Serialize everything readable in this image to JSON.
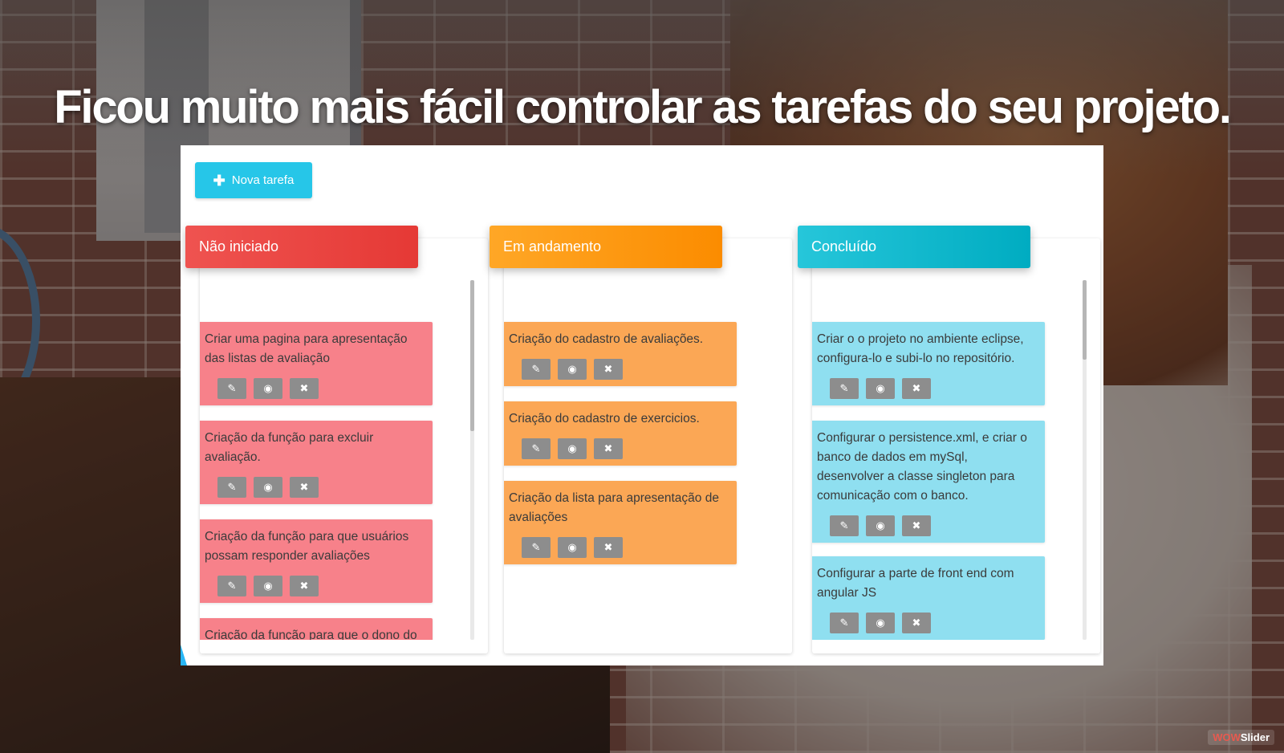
{
  "headline": "Ficou muito mais fácil controlar as tarefas do seu projeto.",
  "toolbar": {
    "new_task_label": "Nova tarefa",
    "new_task_icon": "plus-icon"
  },
  "columns": [
    {
      "title": "Não iniciado",
      "color_start": "#ef5350",
      "color_end": "#e53935",
      "card_color": "#f7818a",
      "scroll_fraction": 0.42,
      "cards": [
        {
          "text": "Criar uma pagina para apresentação das listas de avaliação"
        },
        {
          "text": "Criação da função para excluir avaliação."
        },
        {
          "text": "Criação da função para que usuários possam responder avaliações"
        },
        {
          "text": "Criação da função para que o dono do"
        }
      ]
    },
    {
      "title": "Em andamento",
      "color_start": "#ffa726",
      "color_end": "#fb8c00",
      "card_color": "#fba755",
      "scroll_fraction": 0,
      "cards": [
        {
          "text": "Criação do cadastro de avaliações."
        },
        {
          "text": "Criação do cadastro de exercicios."
        },
        {
          "text": "Criação da lista para apresentação de avaliações"
        }
      ]
    },
    {
      "title": "Concluído",
      "color_start": "#26c6da",
      "color_end": "#00acc1",
      "card_color": "#8fdff0",
      "scroll_fraction": 0.22,
      "cards": [
        {
          "text": "Criar o o projeto no ambiente eclipse, configura-lo e subi-lo no repositório."
        },
        {
          "text": "Configurar o persistence.xml, e criar o banco de dados em mySql, desenvolver a classe singleton para comunicação com o banco."
        },
        {
          "text": "Configurar a parte de front end com angular JS"
        }
      ]
    }
  ],
  "card_actions": [
    {
      "icon": "pencil-icon",
      "glyph": "✎",
      "name": "edit-button"
    },
    {
      "icon": "eye-icon",
      "glyph": "◉",
      "name": "view-button"
    },
    {
      "icon": "close-icon",
      "glyph": "✖",
      "name": "delete-button"
    }
  ],
  "watermark": {
    "part1": "WOW",
    "part2": "Slider"
  }
}
